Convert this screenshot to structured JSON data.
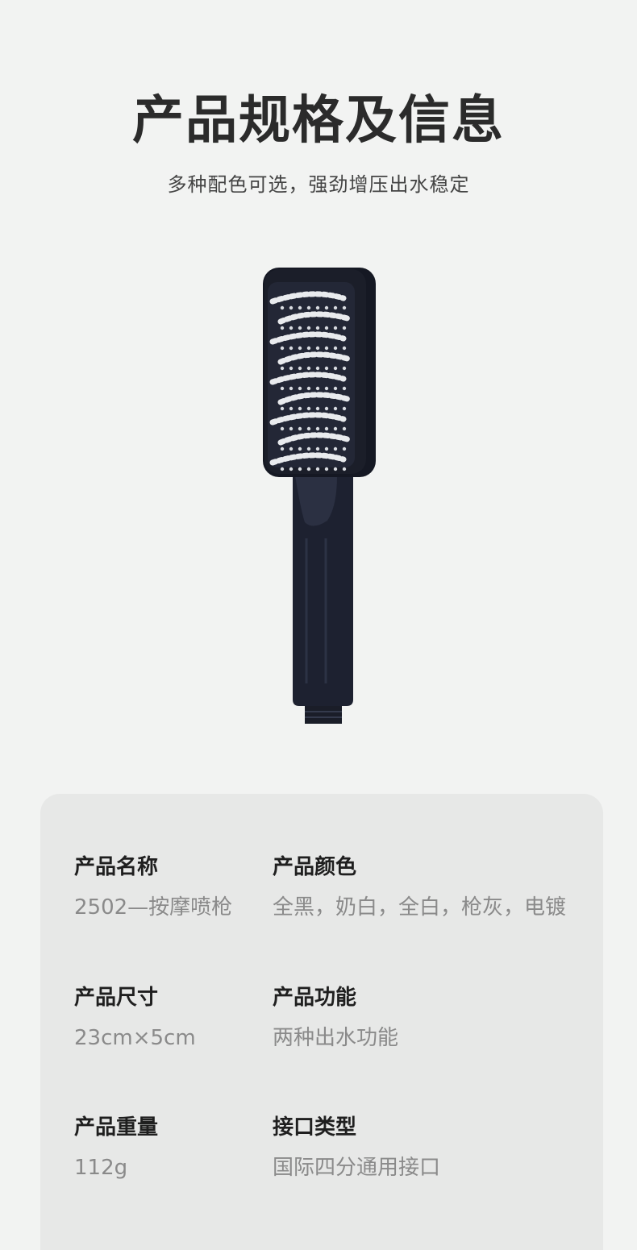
{
  "header": {
    "title": "产品规格及信息",
    "subtitle": "多种配色可选，强劲增压出水稳定"
  },
  "product_image": {
    "icon": "shower-head-icon",
    "color": "#1d2130"
  },
  "specs": [
    {
      "label": "产品名称",
      "value": "2502—按摩喷枪"
    },
    {
      "label": "产品颜色",
      "value": "全黑，奶白，全白，枪灰，电镀"
    },
    {
      "label": "产品尺寸",
      "value": "23cm×5cm"
    },
    {
      "label": "产品功能",
      "value": "两种出水功能"
    },
    {
      "label": "产品重量",
      "value": "112g"
    },
    {
      "label": "接口类型",
      "value": "国际四分通用接口"
    }
  ],
  "colors": {
    "background": "#f2f3f2",
    "card": "#e7e8e7",
    "label": "#1f1f1f",
    "value": "#8a8a8a"
  }
}
